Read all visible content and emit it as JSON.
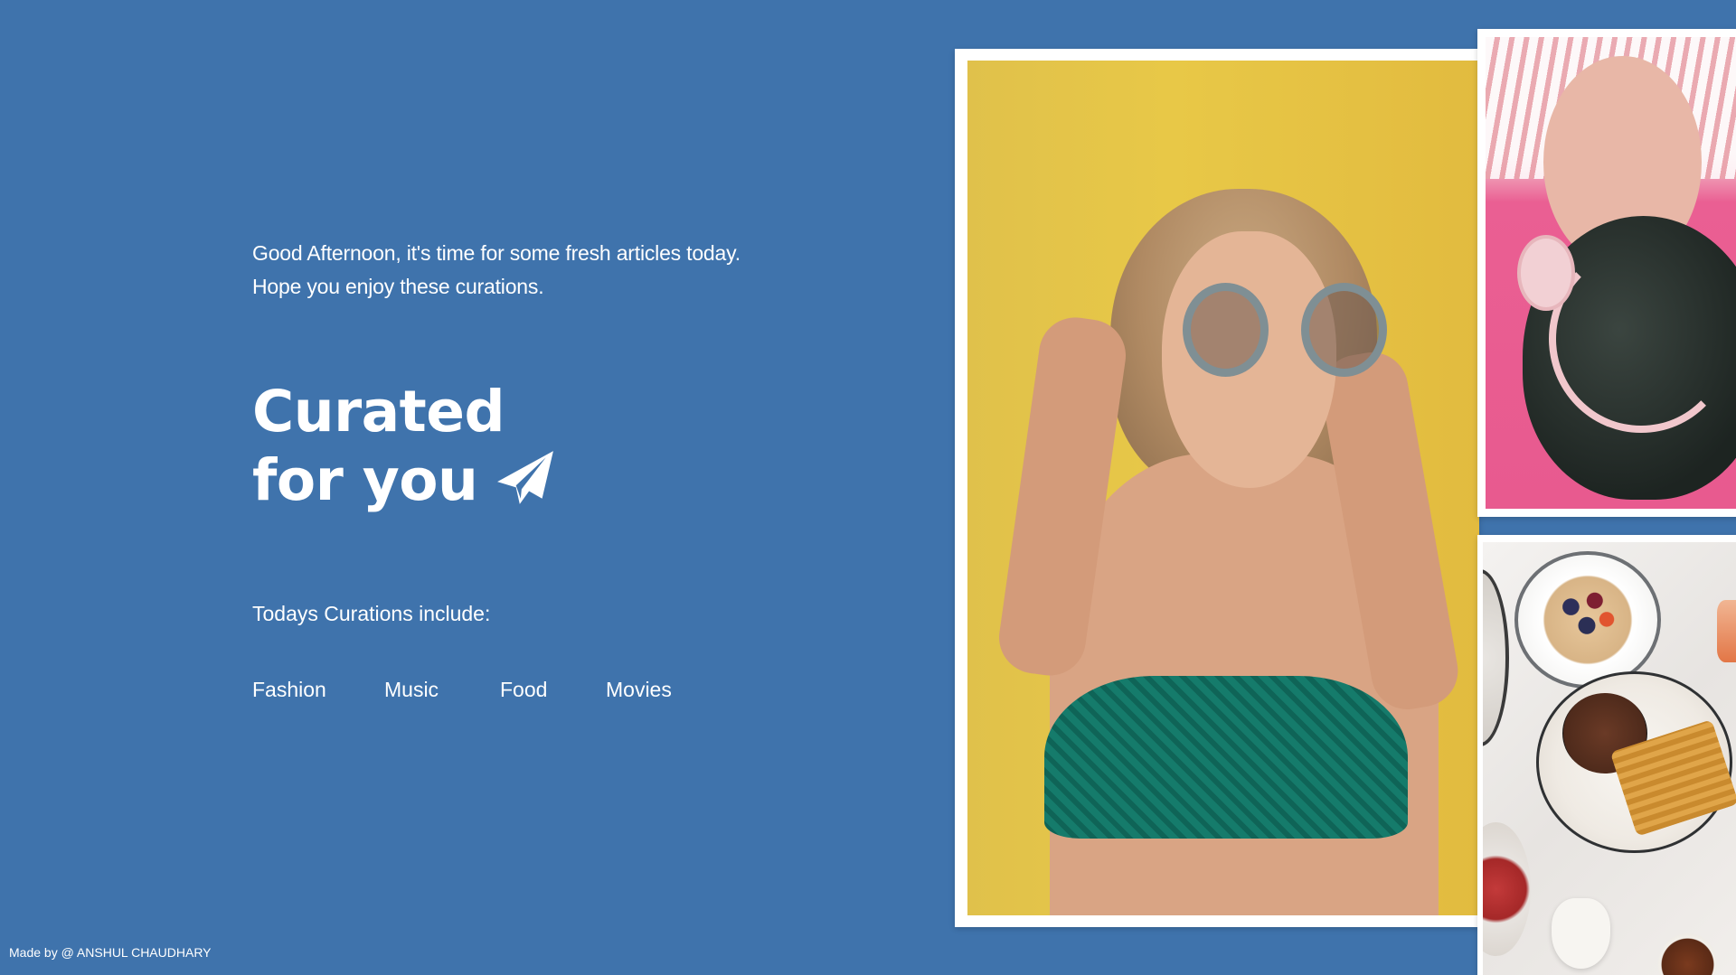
{
  "greeting": {
    "line1": "Good Afternoon, it's time for some fresh articles today.",
    "line2": "Hope you enjoy these curations."
  },
  "headline": {
    "line1": "Curated",
    "line2": "for you",
    "icon": "paper-plane-icon"
  },
  "curations": {
    "label": "Todays Curations include:",
    "categories": [
      "Fashion",
      "Music",
      "Food",
      "Movies"
    ]
  },
  "footer": {
    "prefix": "Made by @ ",
    "author": "ANSHUL CHAUDHARY"
  },
  "colors": {
    "background": "#3f73ac",
    "text": "#ffffff",
    "frame": "#ffffff"
  }
}
